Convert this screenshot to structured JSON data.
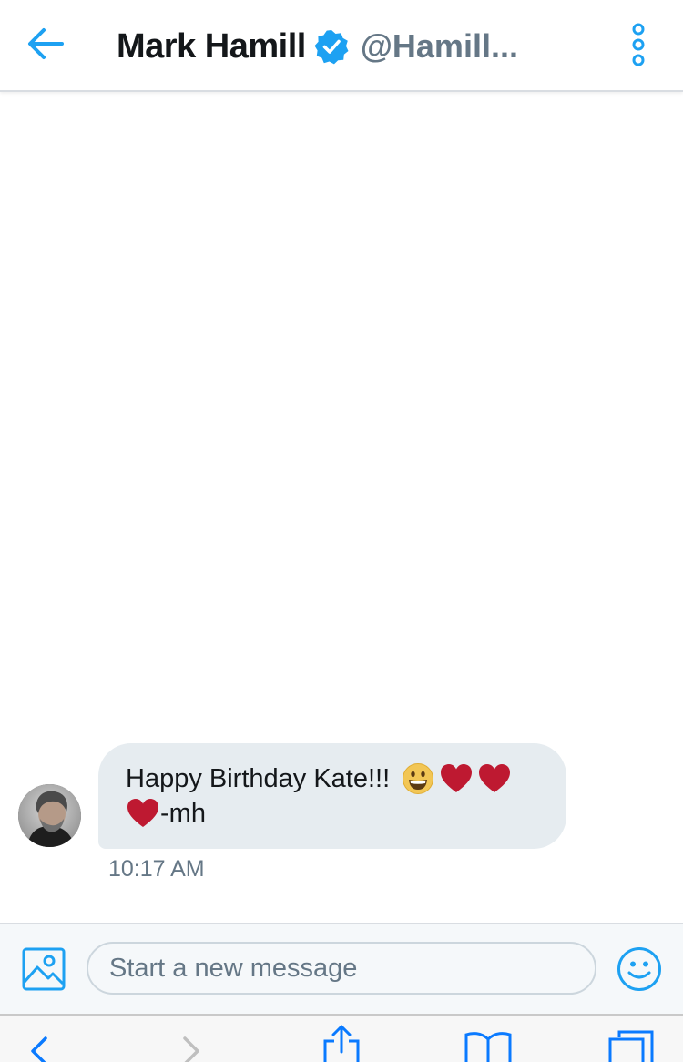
{
  "header": {
    "name": "Mark Hamill",
    "handle": "@Hamill...",
    "verified": true
  },
  "message": {
    "line1_text": "Happy Birthday Kate!!!",
    "line2_text": "-mh",
    "emojis": [
      "grinning-face",
      "red-heart",
      "red-heart",
      "red-heart"
    ],
    "timestamp": "10:17 AM"
  },
  "compose": {
    "placeholder": "Start a new message"
  },
  "colors": {
    "accent": "#1da1f2",
    "bubble": "#e6ecf0",
    "heart": "#be1931",
    "muted": "#657786"
  },
  "icons": {
    "back": "back-arrow-icon",
    "more": "more-vertical-icon",
    "verified": "verified-badge-icon",
    "media": "image-icon",
    "emoji": "smiley-icon"
  }
}
